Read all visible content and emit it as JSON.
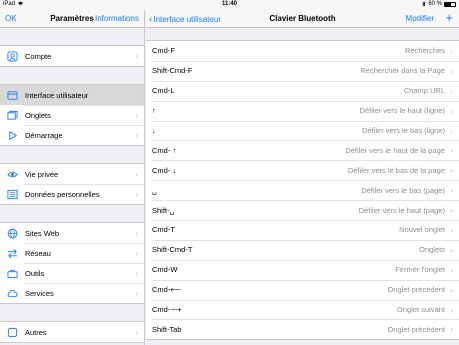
{
  "status": {
    "device": "iPad",
    "wifi_icon": "wifi-icon",
    "time": "11:40",
    "bluetooth_icon": "bluetooth-icon",
    "battery": "60 %",
    "battery_level": 0.6
  },
  "master": {
    "done_label": "OK",
    "title": "Paramètres",
    "info_label": "Informations",
    "groups": [
      [
        {
          "label": "Compte",
          "icon": "user-icon"
        }
      ],
      [
        {
          "label": "Interface utilisateur",
          "icon": "window-icon",
          "selected": true
        },
        {
          "label": "Onglets",
          "icon": "tabs-icon"
        },
        {
          "label": "Démarrage",
          "icon": "play-icon"
        }
      ],
      [
        {
          "label": "Vie privée",
          "icon": "eye-icon"
        },
        {
          "label": "Données personnelles",
          "icon": "list-icon"
        }
      ],
      [
        {
          "label": "Sites Web",
          "icon": "globe-icon"
        },
        {
          "label": "Réseau",
          "icon": "arrows-icon"
        },
        {
          "label": "Outils",
          "icon": "toolbox-icon"
        },
        {
          "label": "Services",
          "icon": "cloud-icon"
        }
      ],
      [
        {
          "label": "Autres",
          "icon": "other-icon"
        }
      ]
    ]
  },
  "detail": {
    "back_label": "Interface utilisateur",
    "title": "Clavier Bluetooth",
    "edit_label": "Modifier",
    "add_label": "+",
    "shortcuts": [
      {
        "key": "Cmd-F",
        "action": "Recherches"
      },
      {
        "key": "Shift-Cmd-F",
        "action": "Rechercher dans la Page"
      },
      {
        "key": "Cmd-L",
        "action": "Champ URL"
      },
      {
        "key": "↑",
        "action": "Défiler vers le haut (ligne)"
      },
      {
        "key": "↓",
        "action": "Défiler vers le bas (ligne)"
      },
      {
        "key": "Cmd- ↑",
        "action": "Défiler vers le haut de la page"
      },
      {
        "key": "Cmd- ↓",
        "action": "Défiler vers le bas de la page"
      },
      {
        "key": "␣",
        "action": "Défiler vers le bas (page)"
      },
      {
        "key": "Shift-␣",
        "action": "Défiler vers le haut (page)"
      },
      {
        "key": "Cmd-T",
        "action": "Nouvel onglet"
      },
      {
        "key": "Shift-Cmd-T",
        "action": "Onglets"
      },
      {
        "key": "Cmd-W",
        "action": "Fermer l'onglet"
      },
      {
        "key": "Cmd-⟵",
        "action": "Onglet précédent"
      },
      {
        "key": "Cmd-⟶",
        "action": "Onglet suivant"
      },
      {
        "key": "Shift-Tab",
        "action": "Onglet précédent"
      }
    ]
  },
  "colors": {
    "accent": "#157efb",
    "selected_row": "#d9d9d9",
    "secondary_text": "#8e8e93"
  }
}
